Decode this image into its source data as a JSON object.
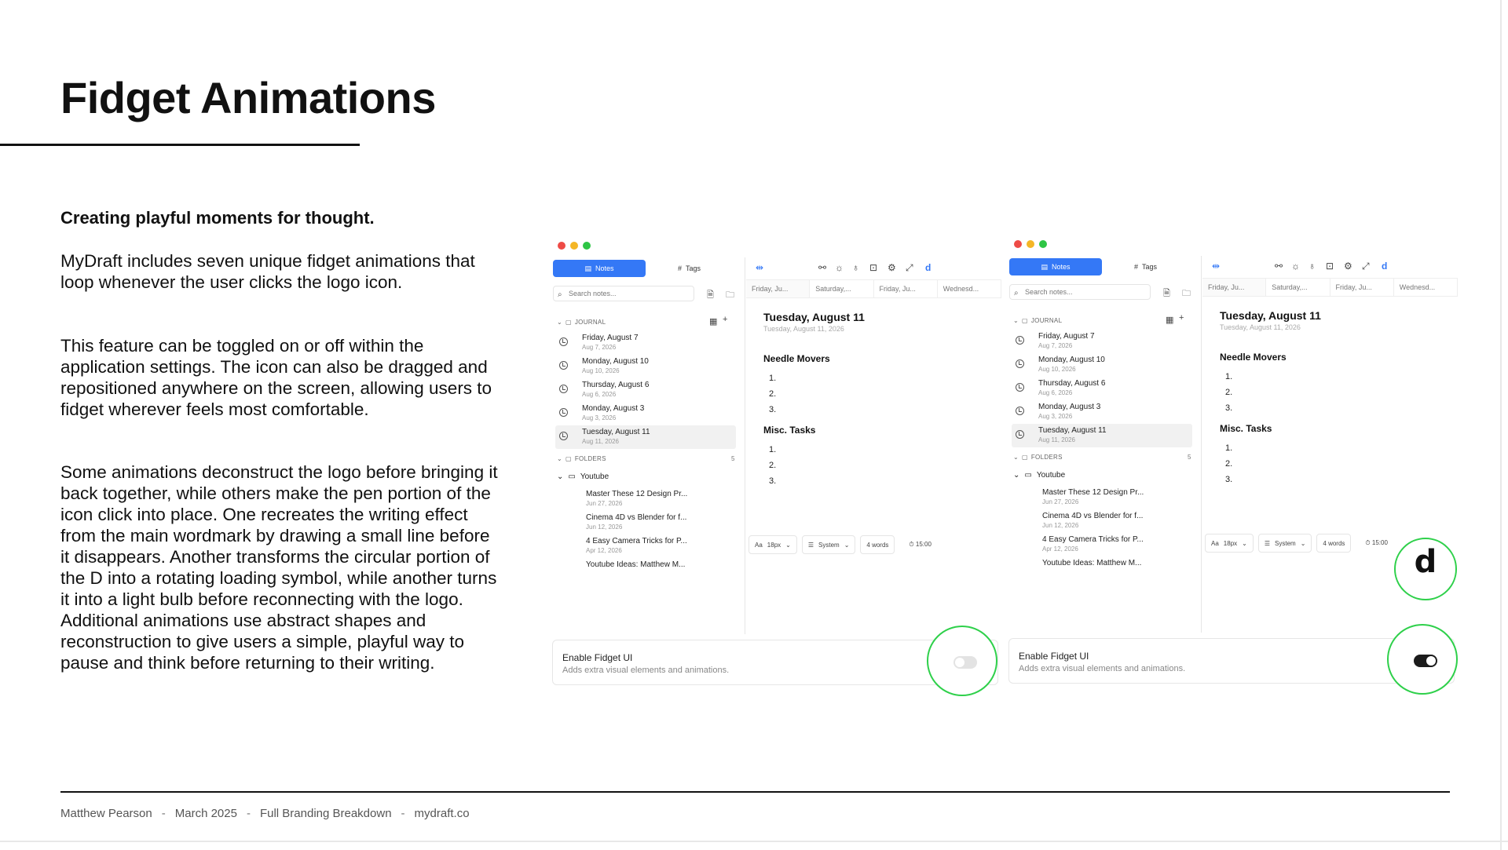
{
  "slide": {
    "title": "Fidget Animations",
    "subtitle": "Creating playful moments for thought.",
    "paragraphs": [
      "MyDraft includes seven unique fidget animations that loop whenever the user clicks the logo icon.",
      "This feature can be toggled on or off within the application settings. The icon can also be dragged and repositioned anywhere on the screen, allowing users to fidget wherever feels most comfortable.",
      "Some animations deconstruct the logo before bringing it back together, while others make the pen portion of the icon click into place. One recreates the writing effect from the main wordmark by drawing a small line before it disappears. Another transforms the circular portion of the D into a rotating loading symbol, while another turns it into a light bulb before reconnecting with the logo. Additional animations use abstract shapes and reconstruction to give users a simple, playful way to pause and think before returning to their writing."
    ],
    "footer": {
      "author": "Matthew Pearson",
      "date": "March 2025",
      "doc": "Full Branding Breakdown",
      "site": "mydraft.co",
      "separator": "-"
    }
  },
  "app": {
    "notes_label": "Notes",
    "tags_label": "Tags",
    "search_placeholder": "Search notes...",
    "journal_label": "JOURNAL",
    "folders_label": "FOLDERS",
    "folders_count": "5",
    "journal_entries": [
      {
        "title": "Friday, August 7",
        "date": "Aug 7, 2026"
      },
      {
        "title": "Monday, August 10",
        "date": "Aug 10, 2026"
      },
      {
        "title": "Thursday, August 6",
        "date": "Aug 6, 2026"
      },
      {
        "title": "Monday, August 3",
        "date": "Aug 3, 2026"
      },
      {
        "title": "Tuesday, August 11",
        "date": "Aug 11, 2026"
      }
    ],
    "folder_name": "Youtube",
    "folder_items": [
      {
        "title": "Master These 12 Design Pr...",
        "date": "Jun 27, 2026"
      },
      {
        "title": "Cinema 4D vs Blender for f...",
        "date": "Jun 12, 2026"
      },
      {
        "title": "4 Easy Camera Tricks for P...",
        "date": "Apr 12, 2026"
      },
      {
        "title": "Youtube Ideas: Matthew M...",
        "date": ""
      }
    ],
    "date_tabs": [
      "Friday, Ju...",
      "Saturday,...",
      "Friday, Ju...",
      "Wednesd..."
    ],
    "doc_title": "Tuesday, August 11",
    "doc_subtitle": "Tuesday, August 11, 2026",
    "section1": "Needle Movers",
    "section2": "Misc. Tasks",
    "list_items": [
      "1.",
      "2.",
      "3."
    ],
    "font_size": "18px",
    "theme": "System",
    "word_count": "4 words",
    "timer": "15:00",
    "setting_title": "Enable Fidget UI",
    "setting_desc": "Adds extra visual elements and animations.",
    "logo_glyph": "d"
  },
  "mockups": [
    {
      "fidget_enabled": false
    },
    {
      "fidget_enabled": true
    }
  ]
}
